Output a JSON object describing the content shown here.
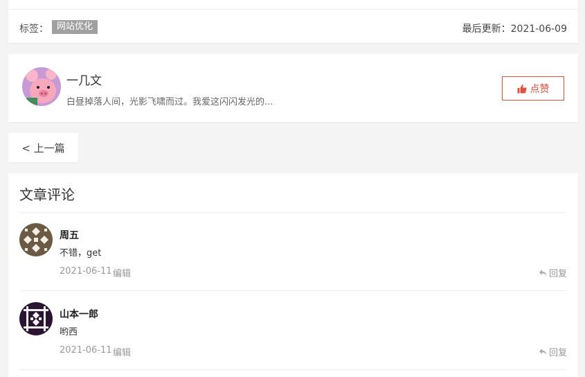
{
  "article_meta": {
    "tags_label": "标签：",
    "tag": "网站优化",
    "updated": "最后更新：2021-06-09"
  },
  "author": {
    "name": "一几文",
    "bio": "白昼掉落人间，光影飞啸而过。我爱这闪闪发光的...",
    "like_label": "点赞"
  },
  "nav": {
    "prev_label": "< 上一篇"
  },
  "comments": {
    "title": "文章评论",
    "items": [
      {
        "name": "周五",
        "text": "不错，get",
        "date": "2021-06-11",
        "edit_label": "编辑",
        "reply_label": "回复",
        "avatar_color": "#6b5a44"
      },
      {
        "name": "山本一郎",
        "text": "哟西",
        "date": "2021-06-11",
        "edit_label": "编辑",
        "reply_label": "回复",
        "avatar_color": "#2a1530"
      }
    ]
  },
  "colors": {
    "accent": "#d9533f",
    "tag_bg": "#a0a0a0",
    "page_bg": "#f4f4f4"
  },
  "icons": {
    "like": "thumbs-up-icon",
    "reply": "reply-arrow-icon"
  }
}
